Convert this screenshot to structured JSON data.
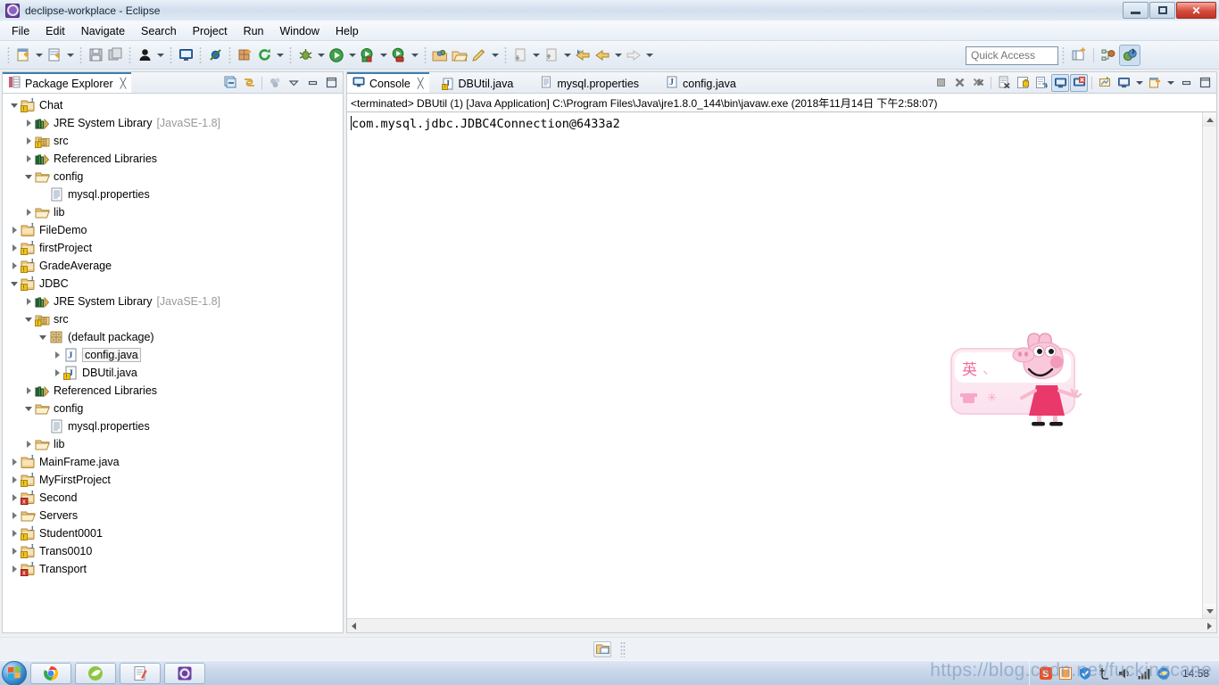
{
  "window": {
    "title": "declipse-workplace - Eclipse",
    "app_icon": "eclipse-icon",
    "minimize_label": "Minimize",
    "restore_label": "Restore",
    "close_label": "Close"
  },
  "menu": {
    "items": [
      {
        "label": "File"
      },
      {
        "label": "Edit"
      },
      {
        "label": "Navigate"
      },
      {
        "label": "Search"
      },
      {
        "label": "Project"
      },
      {
        "label": "Run"
      },
      {
        "label": "Window"
      },
      {
        "label": "Help"
      }
    ]
  },
  "toolbar": {
    "quick_access_placeholder": "Quick Access",
    "buttons": [
      {
        "name": "new-wizard",
        "icon": "new-file-icon"
      },
      {
        "name": "new-dropdown",
        "icon": "chevron-down-icon"
      },
      {
        "name": "new-java-class",
        "icon": "new-class-icon"
      },
      {
        "name": "new-class-dropdown",
        "icon": "chevron-down-icon"
      },
      {
        "name": "save",
        "icon": "save-icon"
      },
      {
        "name": "save-all",
        "icon": "save-all-icon"
      },
      {
        "name": "person",
        "icon": "person-icon"
      },
      {
        "name": "person-dropdown",
        "icon": "chevron-down-icon"
      },
      {
        "name": "console-view",
        "icon": "console-icon"
      },
      {
        "name": "skip-breakpoints",
        "icon": "skip-breakpoints-icon"
      },
      {
        "name": "new-package",
        "icon": "new-package-icon"
      },
      {
        "name": "refresh",
        "icon": "refresh-icon"
      },
      {
        "name": "refresh-dropdown",
        "icon": "chevron-down-icon"
      },
      {
        "name": "debug",
        "icon": "debug-bug-icon"
      },
      {
        "name": "debug-dropdown",
        "icon": "chevron-down-icon"
      },
      {
        "name": "run",
        "icon": "run-play-icon"
      },
      {
        "name": "run-dropdown",
        "icon": "chevron-down-icon"
      },
      {
        "name": "run-as-server",
        "icon": "run-server-icon"
      },
      {
        "name": "run-server-dropdown",
        "icon": "chevron-down-icon"
      },
      {
        "name": "run-on-tomcat",
        "icon": "run-tomcat-icon"
      },
      {
        "name": "tomcat-dropdown",
        "icon": "chevron-down-icon"
      },
      {
        "name": "open-type",
        "icon": "open-type-icon"
      },
      {
        "name": "open-resource",
        "icon": "open-folder-icon"
      },
      {
        "name": "edit-marker",
        "icon": "pencil-icon"
      },
      {
        "name": "marker-dropdown",
        "icon": "chevron-down-icon"
      },
      {
        "name": "next-annotation",
        "icon": "next-annotation-icon"
      },
      {
        "name": "next-dropdown",
        "icon": "chevron-down-icon"
      },
      {
        "name": "prev-annotation",
        "icon": "prev-annotation-icon"
      },
      {
        "name": "prev-dropdown",
        "icon": "chevron-down-icon"
      },
      {
        "name": "last-edit-location",
        "icon": "last-edit-icon"
      },
      {
        "name": "back",
        "icon": "back-arrow-icon"
      },
      {
        "name": "back-dropdown",
        "icon": "chevron-down-icon"
      },
      {
        "name": "forward",
        "icon": "forward-arrow-icon"
      },
      {
        "name": "forward-dropdown",
        "icon": "chevron-down-icon"
      }
    ],
    "perspective_new": "open-perspective-icon",
    "perspective_javaee": "java-ee-perspective-icon",
    "perspective_java": "java-perspective-icon"
  },
  "package_explorer": {
    "tab_label": "Package Explorer",
    "tab_icon": "package-explorer-icon",
    "tab_close": "╳",
    "tools": [
      {
        "name": "collapse-all",
        "icon": "collapse-all-icon"
      },
      {
        "name": "link-with-editor",
        "icon": "link-editor-icon"
      },
      {
        "name": "view-menu-filters",
        "icon": "filters-icon"
      },
      {
        "name": "view-menu",
        "icon": "view-menu-icon"
      },
      {
        "name": "minimize-view",
        "icon": "minimize-icon"
      },
      {
        "name": "maximize-view",
        "icon": "maximize-icon"
      }
    ],
    "tree": [
      {
        "label": "Chat",
        "indent": 0,
        "twisty": "open",
        "icon": "java-project-warning",
        "selected": false
      },
      {
        "label": "JRE System Library",
        "suffix": "[JavaSE-1.8]",
        "indent": 1,
        "twisty": "closed",
        "icon": "library",
        "selected": false
      },
      {
        "label": "src",
        "indent": 1,
        "twisty": "closed",
        "icon": "source-folder",
        "selected": false
      },
      {
        "label": "Referenced Libraries",
        "indent": 1,
        "twisty": "closed",
        "icon": "library",
        "selected": false
      },
      {
        "label": "config",
        "indent": 1,
        "twisty": "open",
        "icon": "folder",
        "selected": false
      },
      {
        "label": "mysql.properties",
        "indent": 2,
        "twisty": "none",
        "icon": "file",
        "selected": false
      },
      {
        "label": "lib",
        "indent": 1,
        "twisty": "closed",
        "icon": "folder",
        "selected": false
      },
      {
        "label": "FileDemo",
        "indent": 0,
        "twisty": "closed",
        "icon": "project-plain",
        "selected": false
      },
      {
        "label": "firstProject",
        "indent": 0,
        "twisty": "closed",
        "icon": "java-project-warning",
        "selected": false
      },
      {
        "label": "GradeAverage",
        "indent": 0,
        "twisty": "closed",
        "icon": "java-project-warning",
        "selected": false
      },
      {
        "label": "JDBC",
        "indent": 0,
        "twisty": "open",
        "icon": "java-project-warning",
        "selected": false
      },
      {
        "label": "JRE System Library",
        "suffix": "[JavaSE-1.8]",
        "indent": 1,
        "twisty": "closed",
        "icon": "library",
        "selected": false
      },
      {
        "label": "src",
        "indent": 1,
        "twisty": "open",
        "icon": "source-folder",
        "selected": false
      },
      {
        "label": "(default package)",
        "indent": 2,
        "twisty": "open",
        "icon": "package",
        "selected": false
      },
      {
        "label": "config.java",
        "indent": 3,
        "twisty": "closed",
        "icon": "java-file",
        "selected": true
      },
      {
        "label": "DBUtil.java",
        "indent": 3,
        "twisty": "closed",
        "icon": "java-file-warning",
        "selected": false
      },
      {
        "label": "Referenced Libraries",
        "indent": 1,
        "twisty": "closed",
        "icon": "library",
        "selected": false
      },
      {
        "label": "config",
        "indent": 1,
        "twisty": "open",
        "icon": "folder",
        "selected": false
      },
      {
        "label": "mysql.properties",
        "indent": 2,
        "twisty": "none",
        "icon": "file",
        "selected": false
      },
      {
        "label": "lib",
        "indent": 1,
        "twisty": "closed",
        "icon": "folder",
        "selected": false
      },
      {
        "label": "MainFrame.java",
        "indent": 0,
        "twisty": "closed",
        "icon": "project-plain",
        "selected": false
      },
      {
        "label": "MyFirstProject",
        "indent": 0,
        "twisty": "closed",
        "icon": "java-project-warning",
        "selected": false
      },
      {
        "label": "Second",
        "indent": 0,
        "twisty": "closed",
        "icon": "java-project-error",
        "selected": false
      },
      {
        "label": "Servers",
        "indent": 0,
        "twisty": "closed",
        "icon": "folder",
        "selected": false
      },
      {
        "label": "Student0001",
        "indent": 0,
        "twisty": "closed",
        "icon": "java-project-warning",
        "selected": false
      },
      {
        "label": "Trans0010",
        "indent": 0,
        "twisty": "closed",
        "icon": "java-project-warning",
        "selected": false
      },
      {
        "label": "Transport",
        "indent": 0,
        "twisty": "closed",
        "icon": "java-project-error",
        "selected": false
      }
    ]
  },
  "editor_area": {
    "tabs": [
      {
        "label": "Console",
        "icon": "console-icon",
        "active": true,
        "closeable": true,
        "close": "╳"
      },
      {
        "label": "DBUtil.java",
        "icon": "java-file-warning-icon",
        "active": false,
        "closeable": false
      },
      {
        "label": "mysql.properties",
        "icon": "file-icon",
        "active": false,
        "closeable": false
      },
      {
        "label": "config.java",
        "icon": "java-file-icon",
        "active": false,
        "closeable": false
      }
    ],
    "tools": [
      {
        "name": "terminate",
        "icon": "terminate-icon"
      },
      {
        "name": "remove-launch",
        "icon": "remove-icon"
      },
      {
        "name": "remove-all-terminated",
        "icon": "remove-all-icon"
      },
      {
        "name": "clear-console",
        "icon": "clear-console-icon"
      },
      {
        "name": "scroll-lock",
        "icon": "scroll-lock-icon"
      },
      {
        "name": "word-wrap",
        "icon": "word-wrap-icon"
      },
      {
        "name": "show-console-on-output",
        "icon": "show-on-output-icon"
      },
      {
        "name": "show-console-on-error",
        "icon": "show-on-error-icon"
      },
      {
        "name": "pin-console",
        "icon": "pin-console-icon"
      },
      {
        "name": "display-selected-console",
        "icon": "display-console-icon"
      },
      {
        "name": "display-console-dropdown",
        "icon": "chevron-down-icon"
      },
      {
        "name": "open-console",
        "icon": "open-console-icon"
      },
      {
        "name": "open-console-dropdown",
        "icon": "chevron-down-icon"
      },
      {
        "name": "minimize-console",
        "icon": "minimize-icon"
      },
      {
        "name": "maximize-console",
        "icon": "maximize-icon"
      }
    ],
    "console_header": "<terminated> DBUtil (1) [Java Application] C:\\Program Files\\Java\\jre1.8.0_144\\bin\\javaw.exe (2018年11月14日 下午2:58:07)",
    "console_output": "com.mysql.jdbc.JDBC4Connection@6433a2"
  },
  "status_bar": {
    "icon": "server-status-icon"
  },
  "ime_panel": {
    "mode_label": "英",
    "separator": "、",
    "skin": "peppa-pig-skin",
    "shirt_icon": "shirt-icon",
    "star_icon": "star-icon"
  },
  "taskbar": {
    "start_label": "Start",
    "tasks": [
      {
        "name": "taskbar-chrome",
        "icon": "chrome-icon"
      },
      {
        "name": "taskbar-browser",
        "icon": "green-browser-icon"
      },
      {
        "name": "taskbar-notepad",
        "icon": "notepad-icon"
      },
      {
        "name": "taskbar-eclipse",
        "icon": "eclipse-icon"
      }
    ],
    "tray": [
      {
        "name": "tray-sogou",
        "icon": "sogou-icon",
        "glyph": "S"
      },
      {
        "name": "tray-archive",
        "icon": "archive-icon"
      },
      {
        "name": "tray-shield",
        "icon": "shield-icon"
      },
      {
        "name": "tray-ime",
        "icon": "ime-icon"
      },
      {
        "name": "tray-volume",
        "icon": "volume-icon"
      },
      {
        "name": "tray-network",
        "icon": "network-icon"
      },
      {
        "name": "tray-explorer",
        "icon": "explorer-icon"
      }
    ],
    "clock": "14:58"
  },
  "watermark": {
    "text": "https://blog.csdn.net/fuckingcane"
  },
  "colors": {
    "accent": "#3c7fb1",
    "selection": "#f4f4f4",
    "dim_text": "#9a9a9a",
    "close_button": "#d64a3c"
  }
}
